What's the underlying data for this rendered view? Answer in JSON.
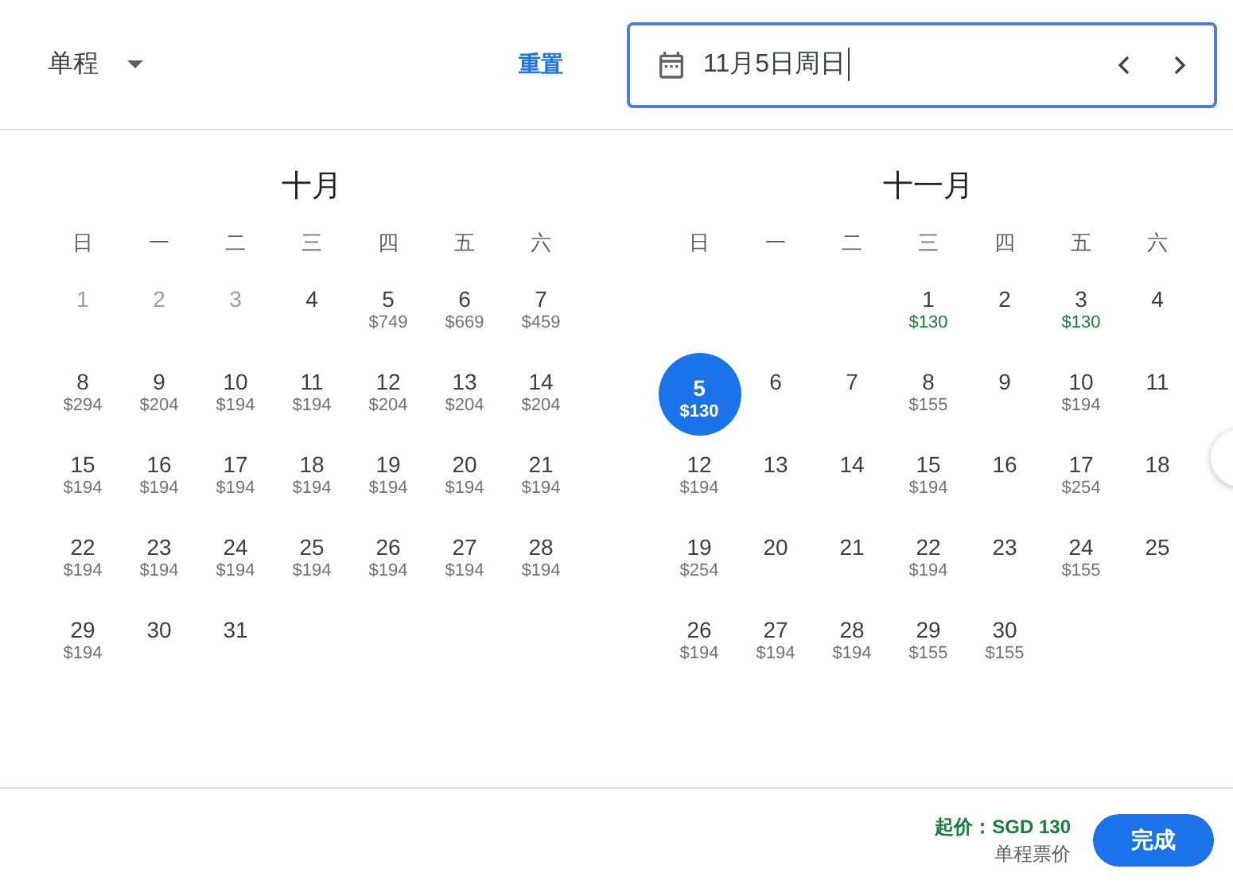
{
  "trip_type": {
    "label": "单程"
  },
  "reset_link": "重置",
  "date_field": {
    "value": "11月5日周日"
  },
  "months": [
    {
      "title": "十月",
      "weekdays": [
        "日",
        "一",
        "二",
        "三",
        "四",
        "五",
        "六"
      ],
      "days": [
        {
          "kind": "day",
          "day": "1",
          "disabled": true,
          "selected": false
        },
        {
          "kind": "day",
          "day": "2",
          "disabled": true,
          "selected": false
        },
        {
          "kind": "day",
          "day": "3",
          "disabled": true,
          "selected": false
        },
        {
          "kind": "day",
          "day": "4",
          "disabled": false,
          "selected": false
        },
        {
          "kind": "day",
          "day": "5",
          "price": "$749",
          "cheapest": false,
          "disabled": false,
          "selected": false
        },
        {
          "kind": "day",
          "day": "6",
          "price": "$669",
          "cheapest": false,
          "disabled": false,
          "selected": false
        },
        {
          "kind": "day",
          "day": "7",
          "price": "$459",
          "cheapest": false,
          "disabled": false,
          "selected": false
        },
        {
          "kind": "day",
          "day": "8",
          "price": "$294",
          "cheapest": false,
          "disabled": false,
          "selected": false
        },
        {
          "kind": "day",
          "day": "9",
          "price": "$204",
          "cheapest": false,
          "disabled": false,
          "selected": false
        },
        {
          "kind": "day",
          "day": "10",
          "price": "$194",
          "cheapest": false,
          "disabled": false,
          "selected": false
        },
        {
          "kind": "day",
          "day": "11",
          "price": "$194",
          "cheapest": false,
          "disabled": false,
          "selected": false
        },
        {
          "kind": "day",
          "day": "12",
          "price": "$204",
          "cheapest": false,
          "disabled": false,
          "selected": false
        },
        {
          "kind": "day",
          "day": "13",
          "price": "$204",
          "cheapest": false,
          "disabled": false,
          "selected": false
        },
        {
          "kind": "day",
          "day": "14",
          "price": "$204",
          "cheapest": false,
          "disabled": false,
          "selected": false
        },
        {
          "kind": "day",
          "day": "15",
          "price": "$194",
          "cheapest": false,
          "disabled": false,
          "selected": false
        },
        {
          "kind": "day",
          "day": "16",
          "price": "$194",
          "cheapest": false,
          "disabled": false,
          "selected": false
        },
        {
          "kind": "day",
          "day": "17",
          "price": "$194",
          "cheapest": false,
          "disabled": false,
          "selected": false
        },
        {
          "kind": "day",
          "day": "18",
          "price": "$194",
          "cheapest": false,
          "disabled": false,
          "selected": false
        },
        {
          "kind": "day",
          "day": "19",
          "price": "$194",
          "cheapest": false,
          "disabled": false,
          "selected": false
        },
        {
          "kind": "day",
          "day": "20",
          "price": "$194",
          "cheapest": false,
          "disabled": false,
          "selected": false
        },
        {
          "kind": "day",
          "day": "21",
          "price": "$194",
          "cheapest": false,
          "disabled": false,
          "selected": false
        },
        {
          "kind": "day",
          "day": "22",
          "price": "$194",
          "cheapest": false,
          "disabled": false,
          "selected": false
        },
        {
          "kind": "day",
          "day": "23",
          "price": "$194",
          "cheapest": false,
          "disabled": false,
          "selected": false
        },
        {
          "kind": "day",
          "day": "24",
          "price": "$194",
          "cheapest": false,
          "disabled": false,
          "selected": false
        },
        {
          "kind": "day",
          "day": "25",
          "price": "$194",
          "cheapest": false,
          "disabled": false,
          "selected": false
        },
        {
          "kind": "day",
          "day": "26",
          "price": "$194",
          "cheapest": false,
          "disabled": false,
          "selected": false
        },
        {
          "kind": "day",
          "day": "27",
          "price": "$194",
          "cheapest": false,
          "disabled": false,
          "selected": false
        },
        {
          "kind": "day",
          "day": "28",
          "price": "$194",
          "cheapest": false,
          "disabled": false,
          "selected": false
        },
        {
          "kind": "day",
          "day": "29",
          "price": "$194",
          "cheapest": false,
          "disabled": false,
          "selected": false
        },
        {
          "kind": "day",
          "day": "30",
          "disabled": false,
          "selected": false
        },
        {
          "kind": "day",
          "day": "31",
          "disabled": false,
          "selected": false
        }
      ]
    },
    {
      "title": "十一月",
      "weekdays": [
        "日",
        "一",
        "二",
        "三",
        "四",
        "五",
        "六"
      ],
      "days": [
        {
          "kind": "blank"
        },
        {
          "kind": "blank"
        },
        {
          "kind": "blank"
        },
        {
          "kind": "day",
          "day": "1",
          "price": "$130",
          "cheapest": true,
          "disabled": false,
          "selected": false
        },
        {
          "kind": "day",
          "day": "2",
          "disabled": false,
          "selected": false
        },
        {
          "kind": "day",
          "day": "3",
          "price": "$130",
          "cheapest": true,
          "disabled": false,
          "selected": false
        },
        {
          "kind": "day",
          "day": "4",
          "disabled": false,
          "selected": false
        },
        {
          "kind": "day",
          "day": "5",
          "price": "$130",
          "cheapest": true,
          "disabled": false,
          "selected": true
        },
        {
          "kind": "day",
          "day": "6",
          "disabled": false,
          "selected": false
        },
        {
          "kind": "day",
          "day": "7",
          "disabled": false,
          "selected": false
        },
        {
          "kind": "day",
          "day": "8",
          "price": "$155",
          "cheapest": false,
          "disabled": false,
          "selected": false
        },
        {
          "kind": "day",
          "day": "9",
          "disabled": false,
          "selected": false
        },
        {
          "kind": "day",
          "day": "10",
          "price": "$194",
          "cheapest": false,
          "disabled": false,
          "selected": false
        },
        {
          "kind": "day",
          "day": "11",
          "disabled": false,
          "selected": false
        },
        {
          "kind": "day",
          "day": "12",
          "price": "$194",
          "cheapest": false,
          "disabled": false,
          "selected": false
        },
        {
          "kind": "day",
          "day": "13",
          "disabled": false,
          "selected": false
        },
        {
          "kind": "day",
          "day": "14",
          "disabled": false,
          "selected": false
        },
        {
          "kind": "day",
          "day": "15",
          "price": "$194",
          "cheapest": false,
          "disabled": false,
          "selected": false
        },
        {
          "kind": "day",
          "day": "16",
          "disabled": false,
          "selected": false
        },
        {
          "kind": "day",
          "day": "17",
          "price": "$254",
          "cheapest": false,
          "disabled": false,
          "selected": false
        },
        {
          "kind": "day",
          "day": "18",
          "disabled": false,
          "selected": false
        },
        {
          "kind": "day",
          "day": "19",
          "price": "$254",
          "cheapest": false,
          "disabled": false,
          "selected": false
        },
        {
          "kind": "day",
          "day": "20",
          "disabled": false,
          "selected": false
        },
        {
          "kind": "day",
          "day": "21",
          "disabled": false,
          "selected": false
        },
        {
          "kind": "day",
          "day": "22",
          "price": "$194",
          "cheapest": false,
          "disabled": false,
          "selected": false
        },
        {
          "kind": "day",
          "day": "23",
          "disabled": false,
          "selected": false
        },
        {
          "kind": "day",
          "day": "24",
          "price": "$155",
          "cheapest": false,
          "disabled": false,
          "selected": false
        },
        {
          "kind": "day",
          "day": "25",
          "disabled": false,
          "selected": false
        },
        {
          "kind": "day",
          "day": "26",
          "price": "$194",
          "cheapest": false,
          "disabled": false,
          "selected": false
        },
        {
          "kind": "day",
          "day": "27",
          "price": "$194",
          "cheapest": false,
          "disabled": false,
          "selected": false
        },
        {
          "kind": "day",
          "day": "28",
          "price": "$194",
          "cheapest": false,
          "disabled": false,
          "selected": false
        },
        {
          "kind": "day",
          "day": "29",
          "price": "$155",
          "cheapest": false,
          "disabled": false,
          "selected": false
        },
        {
          "kind": "day",
          "day": "30",
          "price": "$155",
          "cheapest": false,
          "disabled": false,
          "selected": false
        }
      ]
    }
  ],
  "footer": {
    "lowest_price": "起价：SGD 130",
    "price_note": "单程票价",
    "done_button": "完成"
  }
}
